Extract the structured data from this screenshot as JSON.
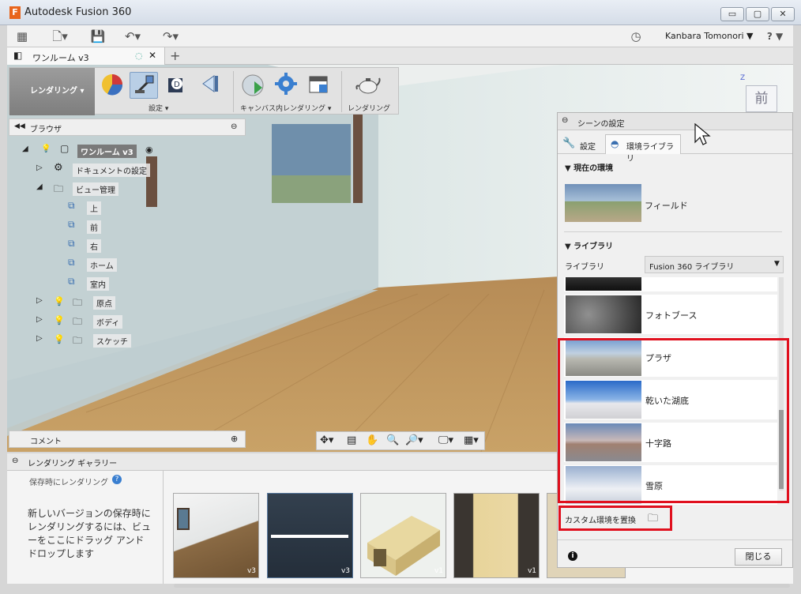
{
  "window": {
    "title": "Autodesk Fusion 360",
    "minimize": "▭",
    "maximize": "▢",
    "close": "✕"
  },
  "menubar": {
    "user": "Kanbara Tomonori ▼",
    "help": "? ▼"
  },
  "document_tab": {
    "title": "ワンルーム v3",
    "new_tab": "+"
  },
  "toolbar": {
    "workspace": "レンダリング ▾",
    "settings_label": "設定 ▾",
    "canvas_render_label": "キャンバス内レンダリング ▾",
    "render_label": "レンダリング"
  },
  "browser": {
    "title": "ブラウザ",
    "items": [
      {
        "label": "ワンルーム v3"
      },
      {
        "label": "ドキュメントの設定"
      },
      {
        "label": "ビュー管理"
      },
      {
        "label": "上"
      },
      {
        "label": "前"
      },
      {
        "label": "右"
      },
      {
        "label": "ホーム"
      },
      {
        "label": "室内"
      },
      {
        "label": "原点"
      },
      {
        "label": "ボディ"
      },
      {
        "label": "スケッチ"
      }
    ]
  },
  "comments": {
    "title": "コメント"
  },
  "viewcube": {
    "face": "前",
    "axis": "Z"
  },
  "gallery": {
    "title": "レンダリング ギャラリー",
    "render_on_save": "保存時にレンダリング",
    "help_text": "新しいバージョンの保存時にレンダリングするには、ビューをここにドラッグ アンド ドロップします",
    "thumbnails": [
      {
        "version": "v3"
      },
      {
        "version": "v3"
      },
      {
        "version": "v1"
      },
      {
        "version": "v1"
      }
    ]
  },
  "scene_settings": {
    "title": "シーンの設定",
    "tab_settings": "設定",
    "tab_env_library": "環境ライブラリ",
    "current_env_header": "現在の環境",
    "current_env_name": "フィールド",
    "library_header": "ライブラリ",
    "library_label": "ライブラリ",
    "library_select": "Fusion 360 ライブラリ",
    "environments": [
      {
        "name": ""
      },
      {
        "name": "フォトブース"
      },
      {
        "name": "プラザ"
      },
      {
        "name": "乾いた湖底"
      },
      {
        "name": "十字路"
      },
      {
        "name": "雪原"
      }
    ],
    "custom_env": "カスタム環境を置換",
    "close_button": "閉じる"
  },
  "colors": {
    "highlight_red": "#e0101e",
    "brand_orange": "#e8641b"
  }
}
